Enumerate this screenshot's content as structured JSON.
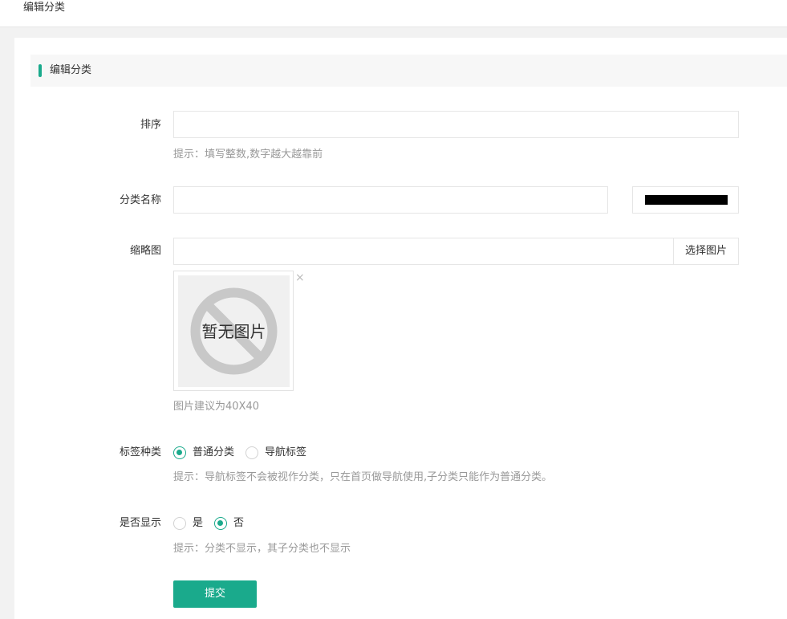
{
  "topbar": {
    "title": "编辑分类"
  },
  "section": {
    "title": "编辑分类"
  },
  "form": {
    "sort": {
      "label": "排序",
      "value": "",
      "tip": "提示：填写整数,数字越大越靠前"
    },
    "name": {
      "label": "分类名称",
      "value": "",
      "color": "#000000"
    },
    "thumbnail": {
      "label": "缩略图",
      "value": "",
      "choose_label": "选择图片",
      "placeholder_text": "暂无图片",
      "close_glyph": "×",
      "tip": "图片建议为40X40"
    },
    "tag_type": {
      "label": "标签种类",
      "options": [
        "普通分类",
        "导航标签"
      ],
      "selected": "普通分类",
      "tip": "提示：导航标签不会被视作分类，只在首页做导航使用,子分类只能作为普通分类。"
    },
    "visible": {
      "label": "是否显示",
      "options": [
        "是",
        "否"
      ],
      "selected": "否",
      "tip": "提示：分类不显示，其子分类也不显示"
    },
    "submit_label": "提交"
  },
  "colors": {
    "accent": "#1aaa8c"
  }
}
